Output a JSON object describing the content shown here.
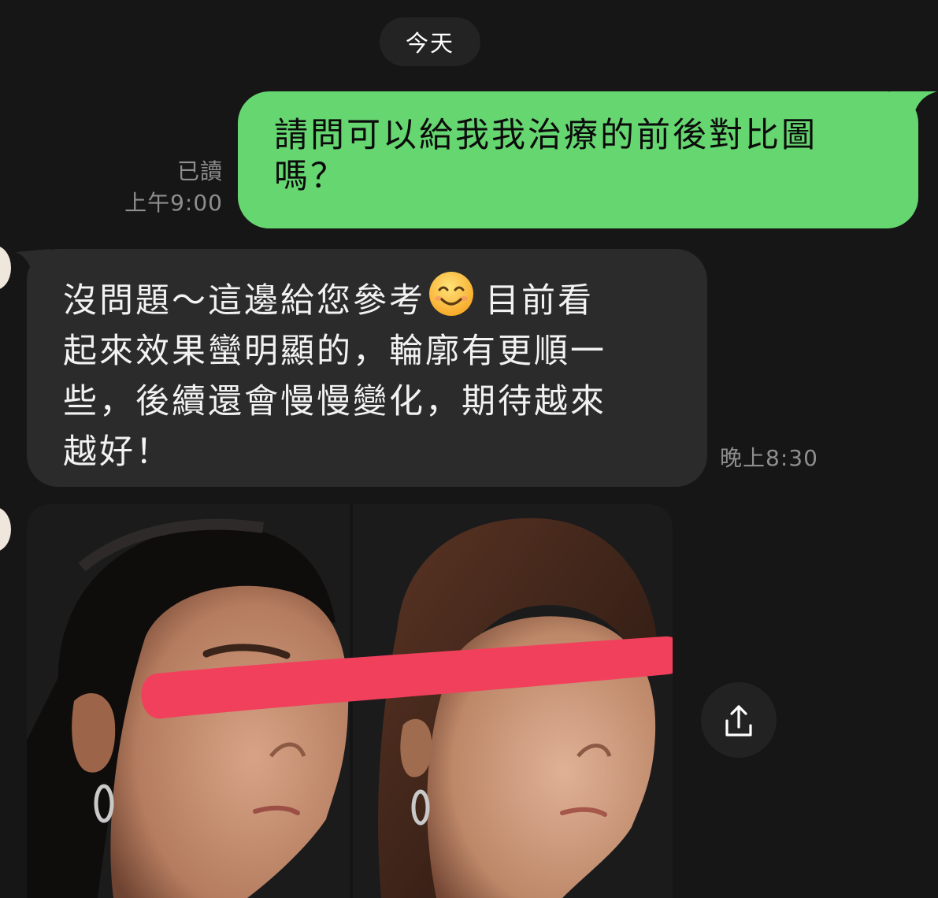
{
  "date_separator": "今天",
  "messages": [
    {
      "direction": "outgoing",
      "lines": [
        "請問可以給我我治療的前後對比圖",
        "嗎？"
      ],
      "read_status": "已讀",
      "time": "上午9:00",
      "bubble_color": "#66d670"
    },
    {
      "direction": "incoming",
      "line1_before_emoji": "沒問題～這邊給您參考",
      "emoji": "smiling-face",
      "line1_after_emoji": "目前看",
      "lines": [
        "起來效果蠻明顯的，輪廓有更順一",
        "些，後續還會慢慢變化，期待越來",
        "越好！"
      ],
      "time": "晚上8:30",
      "bubble_color": "#2b2b2b"
    },
    {
      "direction": "incoming",
      "type": "image",
      "image_description_icon": "before-after-face-photo",
      "action_icon": "share-icon"
    }
  ],
  "colors": {
    "background": "#161616",
    "outgoing_bubble": "#66d670",
    "incoming_bubble": "#2b2b2b",
    "redaction_bar": "#f1405c",
    "meta_text": "#8e8e8e"
  }
}
